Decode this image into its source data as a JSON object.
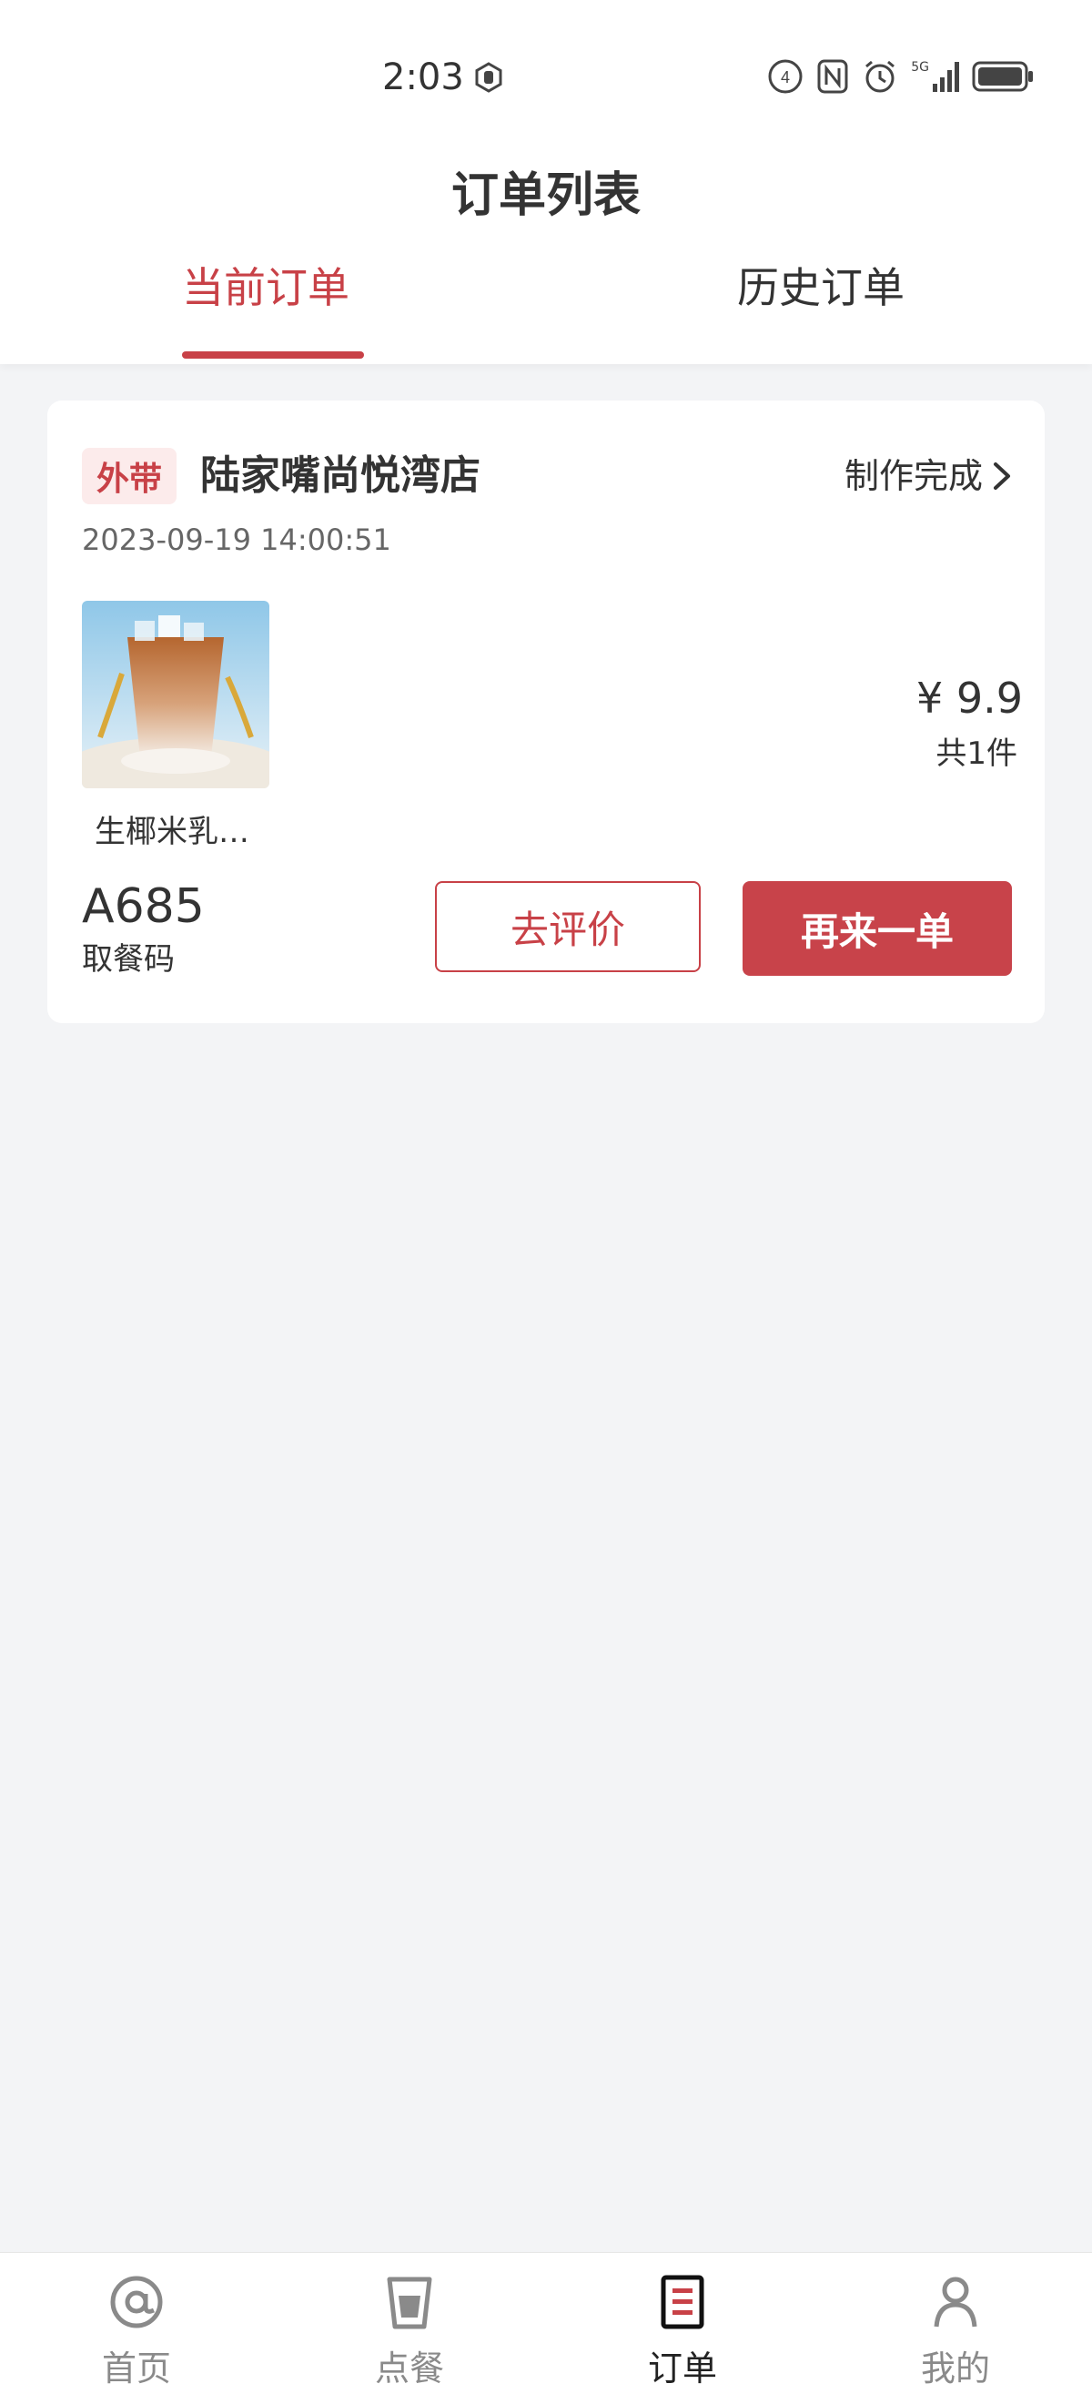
{
  "status_bar": {
    "time": "2:03",
    "signal_label": "5G"
  },
  "header": {
    "title": "订单列表",
    "tabs": [
      {
        "label": "当前订单",
        "active": true
      },
      {
        "label": "历史订单",
        "active": false
      }
    ]
  },
  "order": {
    "tag": "外带",
    "store_name": "陆家嘴尚悦湾店",
    "status": "制作完成",
    "time": "2023-09-19 14:00:51",
    "product_name": "生椰米乳…",
    "price": "¥ 9.9",
    "count": "共1件",
    "pickup_code": "A685",
    "pickup_label": "取餐码",
    "review_button": "去评价",
    "reorder_button": "再来一单"
  },
  "bottom_nav": [
    {
      "label": "首页",
      "icon": "at-icon",
      "active": false
    },
    {
      "label": "点餐",
      "icon": "cup-icon",
      "active": false
    },
    {
      "label": "订单",
      "icon": "order-doc-icon",
      "active": true
    },
    {
      "label": "我的",
      "icon": "person-icon",
      "active": false
    }
  ],
  "colors": {
    "accent": "#c84147",
    "background": "#f3f4f6",
    "card": "#ffffff"
  }
}
